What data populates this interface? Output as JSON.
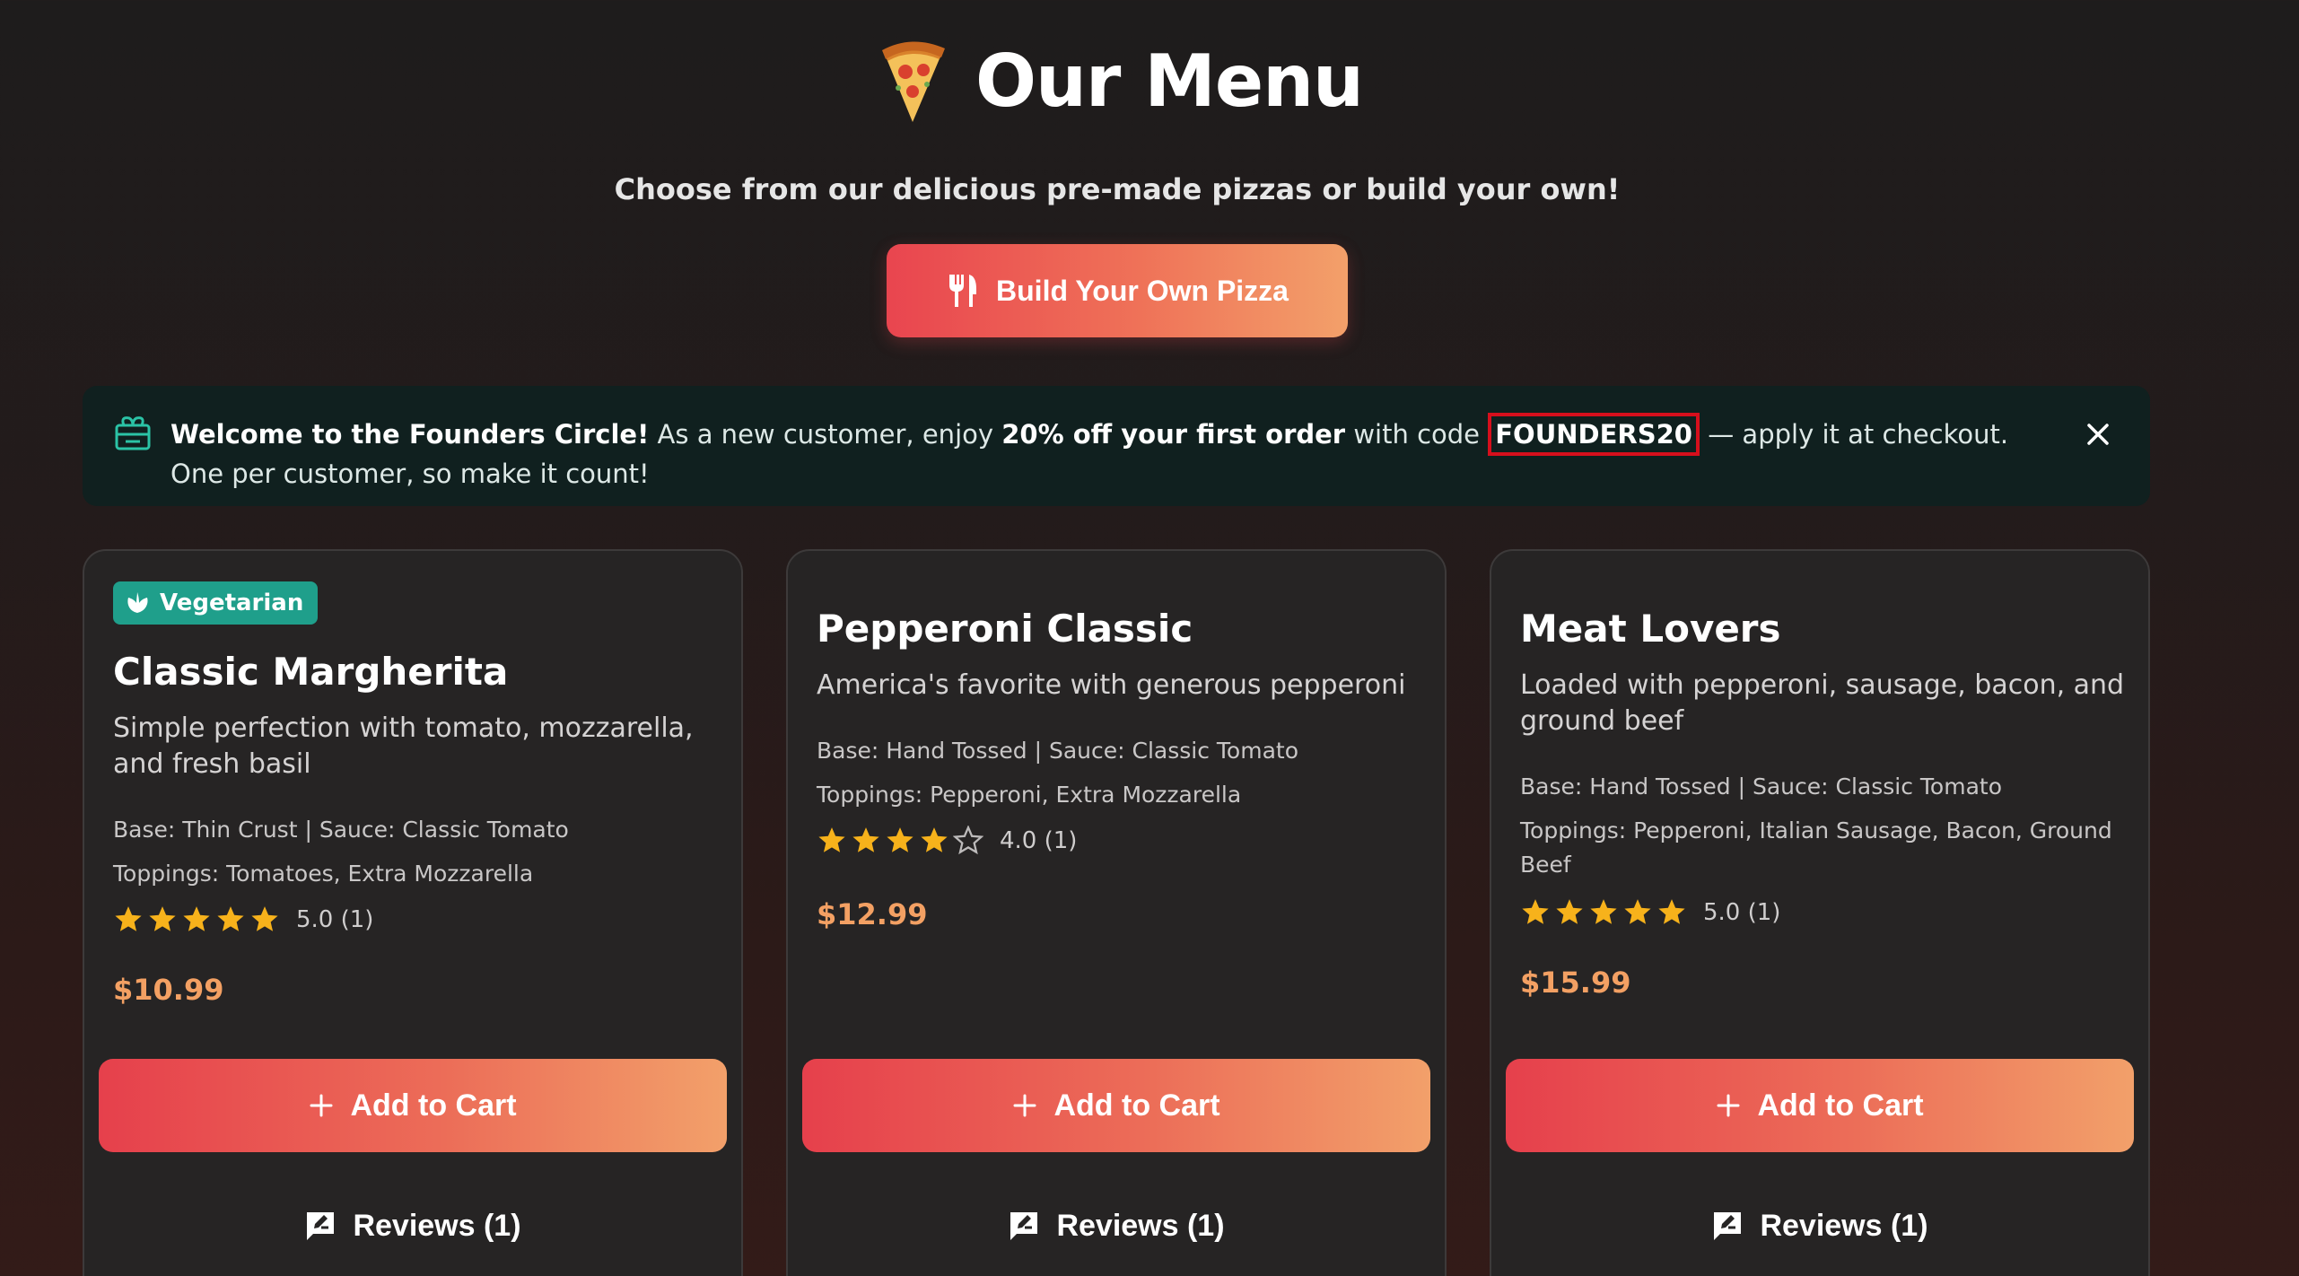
{
  "header": {
    "title": "Our Menu",
    "subtitle": "Choose from our delicious pre-made pizzas or build your own!",
    "build_button_label": "Build Your Own Pizza",
    "title_icon": "pizza-emoji",
    "build_icon": "fork-knife-icon"
  },
  "banner": {
    "icon": "gift-icon",
    "lead": "Welcome to the Founders Circle!",
    "text1": " As a new customer, enjoy ",
    "discount": "20% off your first order",
    "text2": " with code ",
    "code": "FOUNDERS20",
    "text3": " — apply it at checkout. One per customer, so make it count!",
    "close_icon": "close-icon"
  },
  "cards": [
    {
      "badge": "Vegetarian",
      "name": "Classic Margherita",
      "description": "Simple perfection with tomato, mozzarella, and fresh basil",
      "base_sauce": "Base: Thin Crust | Sauce: Classic Tomato",
      "toppings": "Toppings: Tomatoes, Extra Mozzarella",
      "rating": 5,
      "rating_text": "5.0 (1)",
      "price": "$10.99",
      "add_label": "Add to Cart",
      "reviews_label": "Reviews (1)"
    },
    {
      "badge": "",
      "name": "Pepperoni Classic",
      "description": "America's favorite with generous pepperoni",
      "base_sauce": "Base: Hand Tossed | Sauce: Classic Tomato",
      "toppings": "Toppings: Pepperoni, Extra Mozzarella",
      "rating": 4,
      "rating_text": "4.0 (1)",
      "price": "$12.99",
      "add_label": "Add to Cart",
      "reviews_label": "Reviews (1)"
    },
    {
      "badge": "",
      "name": "Meat Lovers",
      "description": "Loaded with pepperoni, sausage, bacon, and ground beef",
      "base_sauce": "Base: Hand Tossed | Sauce: Classic Tomato",
      "toppings": "Toppings: Pepperoni, Italian Sausage, Bacon, Ground Beef",
      "rating": 5,
      "rating_text": "5.0 (1)",
      "price": "$15.99",
      "add_label": "Add to Cart",
      "reviews_label": "Reviews (1)"
    }
  ],
  "colors": {
    "accent_start": "#e9454f",
    "accent_end": "#f3a06a",
    "price": "#f3a063",
    "star": "#f7b21b",
    "badge": "#1f9f8b",
    "code_outline": "#d60f1c"
  }
}
